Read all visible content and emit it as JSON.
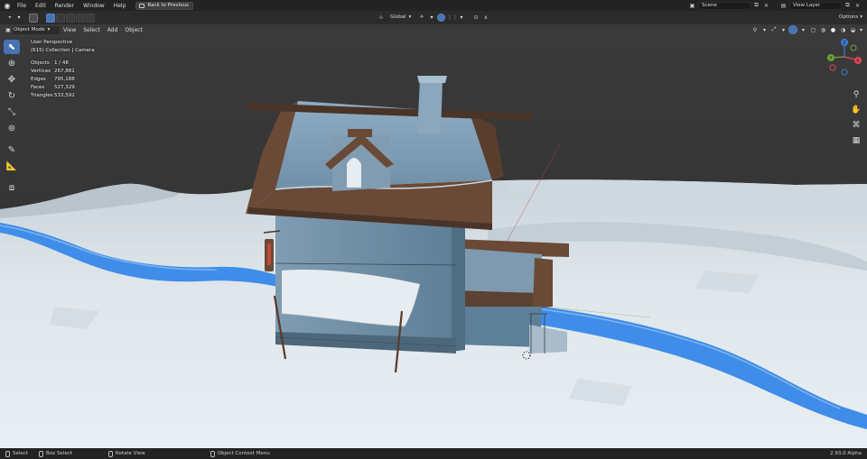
{
  "topbar": {
    "menus": [
      "File",
      "Edit",
      "Render",
      "Window",
      "Help"
    ],
    "back_button": "Back to Previous",
    "scene_field": "Scene",
    "view_layer_field": "View Layer"
  },
  "header": {
    "orientation": "Global",
    "options": "Options"
  },
  "header2": {
    "mode": "Object Mode",
    "menus": [
      "View",
      "Select",
      "Add",
      "Object"
    ]
  },
  "overlay": {
    "view_name": "User Perspective",
    "collection": "(615) Collection | Camera",
    "stats": [
      {
        "label": "Objects",
        "value": "1 / 48"
      },
      {
        "label": "Vertices",
        "value": "267,881"
      },
      {
        "label": "Edges",
        "value": "795,188"
      },
      {
        "label": "Faces",
        "value": "527,329"
      },
      {
        "label": "Triangles",
        "value": "533,592"
      }
    ]
  },
  "gizmo": {
    "axes": [
      "X",
      "Y",
      "Z"
    ],
    "colors": {
      "x": "#e0485a",
      "y": "#6ba336",
      "z": "#3a7fd6"
    }
  },
  "status": {
    "items": [
      "Select",
      "Box Select",
      "Rotate View",
      "Object Context Menu"
    ],
    "version": "2.93.0 Alpha"
  },
  "colors": {
    "accent": "#4772b3",
    "river": "#3f8de8",
    "snow": "#dfe7ec",
    "roof": "#6a4a36",
    "wall": "#5d7f97"
  },
  "icons": [
    "blender-logo",
    "select-box-icon",
    "cursor-icon",
    "move-icon",
    "rotate-icon",
    "scale-icon",
    "transform-icon",
    "annotate-icon",
    "measure-icon",
    "add-cube-icon",
    "zoom-icon",
    "hand-icon",
    "camera-icon",
    "grid-icon"
  ]
}
